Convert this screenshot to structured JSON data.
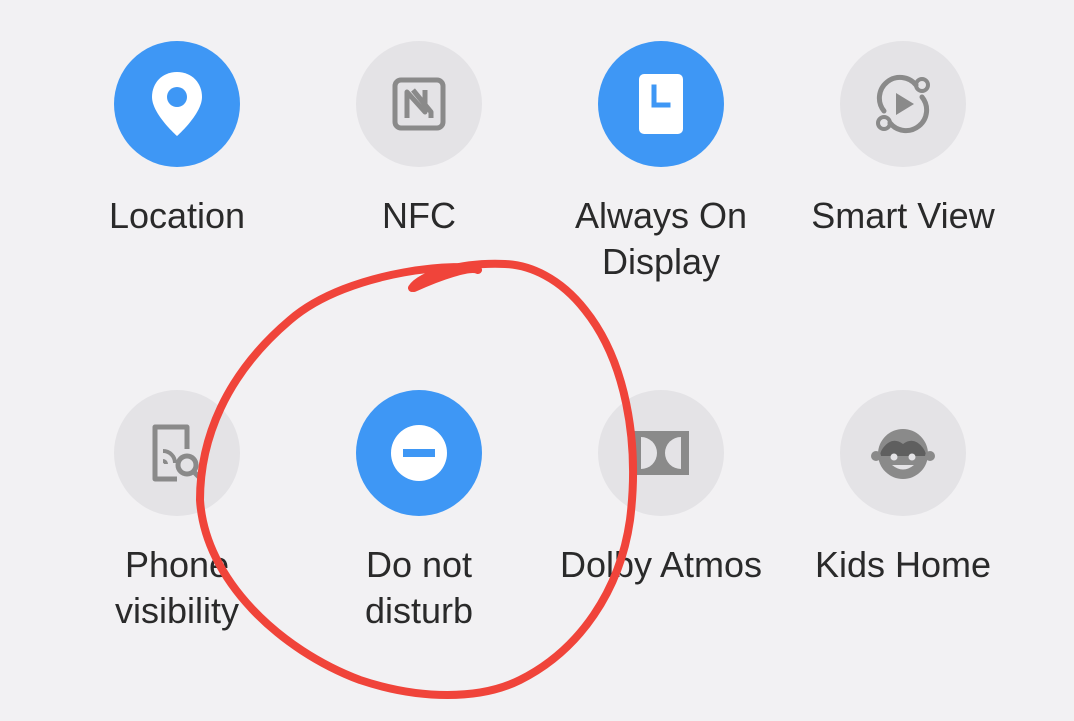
{
  "quick_settings": {
    "tiles": [
      {
        "label": "Location",
        "state": "on",
        "icon": "location-pin-icon"
      },
      {
        "label": "NFC",
        "state": "off",
        "icon": "nfc-icon"
      },
      {
        "label": "Always On Display",
        "state": "on",
        "icon": "always-on-display-icon"
      },
      {
        "label": "Smart View",
        "state": "off",
        "icon": "smart-view-icon"
      },
      {
        "label": "Phone visibility",
        "state": "off",
        "icon": "phone-visibility-icon"
      },
      {
        "label": "Do not disturb",
        "state": "on",
        "icon": "do-not-disturb-icon"
      },
      {
        "label": "Dolby Atmos",
        "state": "off",
        "icon": "dolby-atmos-icon"
      },
      {
        "label": "Kids Home",
        "state": "off",
        "icon": "kids-home-icon"
      }
    ]
  },
  "colors": {
    "background": "#f2f1f3",
    "tile_on": "#3e97f5",
    "tile_off": "#e4e3e6",
    "icon_off": "#8a8a8a",
    "label": "#2a2a2a",
    "annotation": "#f0443a"
  }
}
